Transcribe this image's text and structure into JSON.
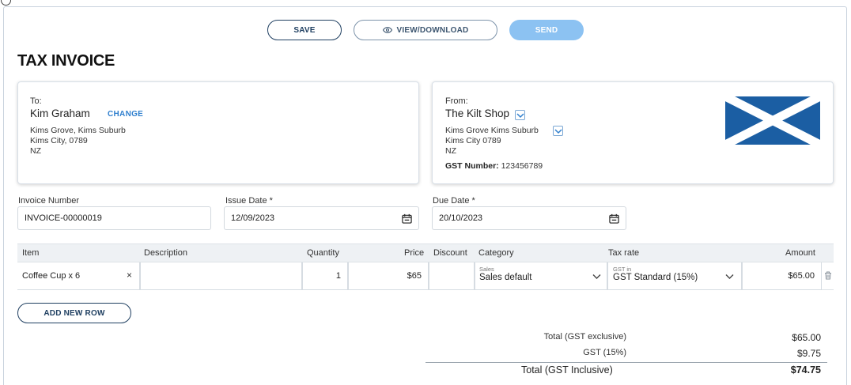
{
  "toolbar": {
    "save_label": "SAVE",
    "view_label": "VIEW/DOWNLOAD",
    "send_label": "SEND"
  },
  "page_title": "TAX INVOICE",
  "to": {
    "label": "To:",
    "name": "Kim Graham",
    "change_label": "CHANGE",
    "address": [
      "Kims Grove, Kims Suburb",
      "Kims City, 0789",
      "NZ"
    ]
  },
  "from": {
    "label": "From:",
    "name": "The Kilt Shop",
    "address": [
      "Kims Grove Kims Suburb",
      "Kims City 0789",
      "NZ"
    ],
    "gst_label": "GST Number:",
    "gst_number": "123456789"
  },
  "colors": {
    "primary": "#1f3f61",
    "accent_blue": "#2f7fce",
    "send_disabled": "#8cc2f2",
    "flag_blue": "#1b5ea3"
  },
  "fields": {
    "invoice_number": {
      "label": "Invoice Number",
      "value": "INVOICE-00000019"
    },
    "issue_date": {
      "label": "Issue Date *",
      "value": "12/09/2023"
    },
    "due_date": {
      "label": "Due Date *",
      "value": "20/10/2023"
    }
  },
  "table": {
    "headers": {
      "item": "Item",
      "description": "Description",
      "quantity": "Quantity",
      "price": "Price",
      "discount": "Discount",
      "category": "Category",
      "tax_rate": "Tax rate",
      "amount": "Amount"
    },
    "row": {
      "item": "Coffee Cup x 6",
      "clear": "×",
      "description": "",
      "quantity": "1",
      "price": "$65",
      "discount": "",
      "category_hint": "Sales",
      "category": "Sales default",
      "tax_hint": "GST in",
      "tax_rate": "GST Standard (15%)",
      "amount": "$65.00"
    }
  },
  "add_row_label": "ADD NEW ROW",
  "totals": {
    "exclusive_label": "Total (GST exclusive)",
    "exclusive_value": "$65.00",
    "gst_label": "GST (15%)",
    "gst_value": "$9.75",
    "inclusive_label": "Total (GST Inclusive)",
    "inclusive_value": "$74.75"
  }
}
